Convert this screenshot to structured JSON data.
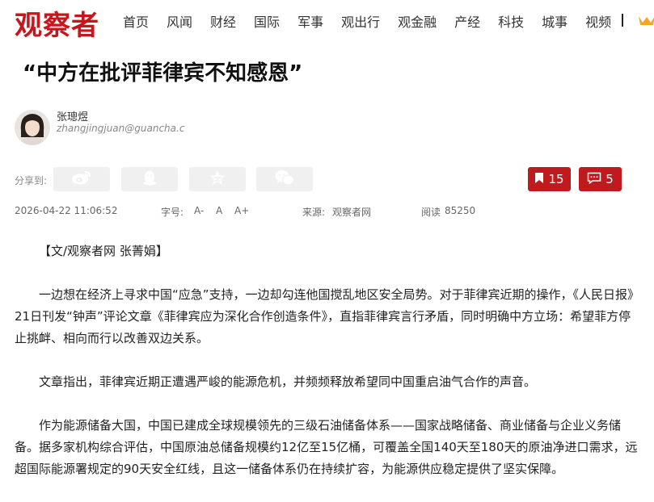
{
  "site": {
    "logo": "观察者"
  },
  "nav": [
    "首页",
    "风闻",
    "财经",
    "国际",
    "军事",
    "观出行",
    "观金融",
    "产经",
    "科技",
    "城事",
    "视频"
  ],
  "article": {
    "title": "“中方在批评菲律宾不知感恩”",
    "author": {
      "name": "张璁煜",
      "email": "zhangjingjuan@guancha.c"
    },
    "share_label": "分享到:",
    "share_icons": [
      "weibo-icon",
      "qq-icon",
      "qzone-star-icon",
      "wechat-icon"
    ],
    "bookmark_count": "15",
    "comment_count": "5",
    "meta": {
      "datetime": "2026-04-22 11:06:52",
      "font_label": "字号:",
      "font_small": "A-",
      "font_normal": "A",
      "font_large": "A+",
      "source_label": "来源:",
      "source": "观察者网",
      "reads_label": "阅读",
      "reads": "85250"
    },
    "paragraphs": [
      "【文/观察者网 张菁娟】",
      "一边想在经济上寻求中国“应急”支持，一边却勾连他国搅乱地区安全局势。对于菲律宾近期的操作，《人民日报》21日刊发“钟声”评论文章《菲律宾应为深化合作创造条件》，直指菲律宾言行矛盾，同时明确中方立场：希望菲方停止挑衅、相向而行以改善双边关系。",
      "文章指出，菲律宾近期正遭遇严峻的能源危机，并频频释放希望同中国重启油气合作的声音。",
      "作为能源储备大国，中国已建成全球规模领先的三级石油储备体系——国家战略储备、商业储备与企业义务储备。据多家机构综合评估，中国原油总储备规模约12亿至15亿桶，可覆盖全国140天至180天的原油净进口需求，远超国际能源署规定的90天安全红线，且这一储备体系仍在持续扩容，为能源供应稳定提供了坚实保障。"
    ]
  },
  "colors": {
    "brand": "#c8161d",
    "action": "#bf1b1f"
  }
}
